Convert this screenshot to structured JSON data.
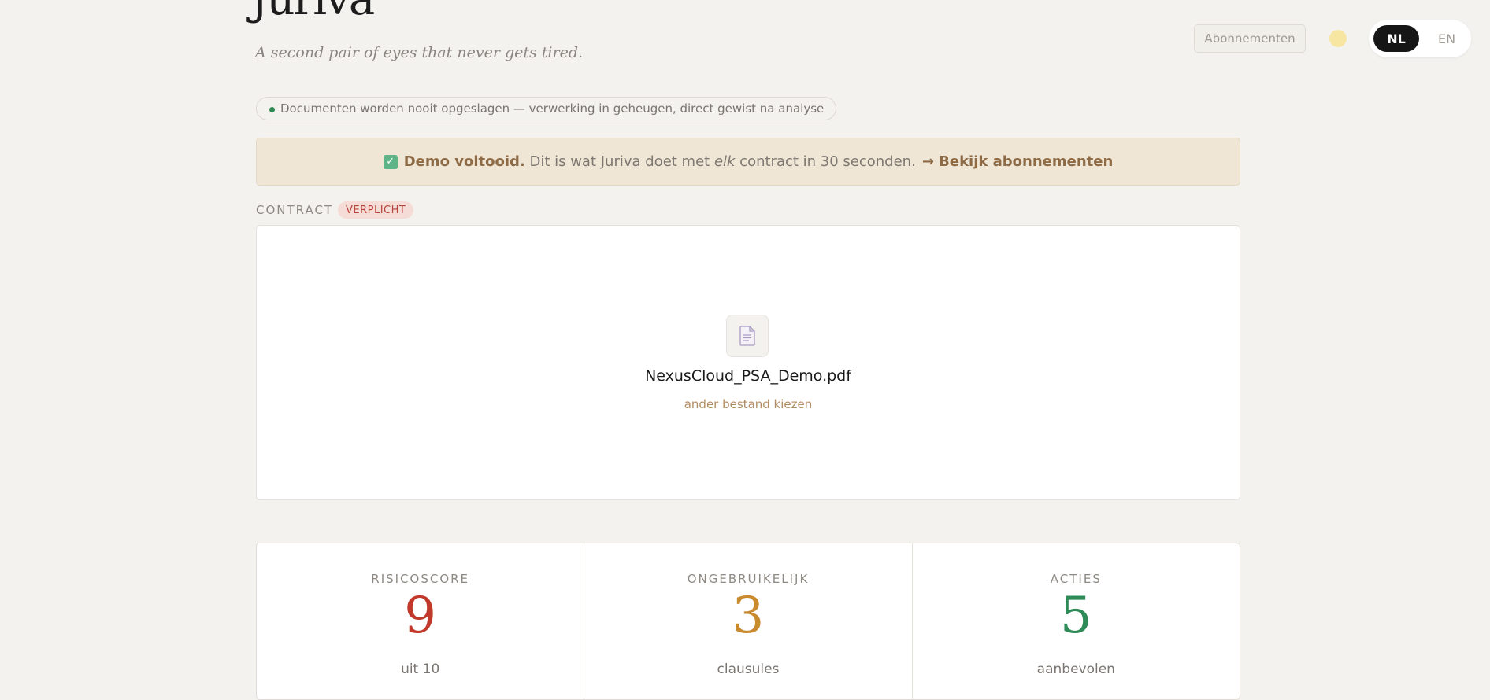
{
  "header": {
    "logo": "Juriva",
    "tagline": "A second pair of eyes that never gets tired.",
    "subscriptions_button": "Abonnementen",
    "theme_icon": "sun-icon",
    "lang": {
      "active": "NL",
      "other": "EN"
    }
  },
  "privacy_notice": "Documenten worden nooit opgeslagen — verwerking in geheugen, direct gewist na analyse",
  "banner": {
    "icon": "checkbox-icon",
    "bold": "Demo voltooid.",
    "text_before": " Dit is wat Juriva doet met ",
    "em": "elk",
    "text_after": " contract in 30 seconden.",
    "link": "→ Bekijk abonnementen"
  },
  "contract": {
    "label": "CONTRACT",
    "required_badge": "VERPLICHT",
    "file_icon": "document-icon",
    "file_name": "NexusCloud_PSA_Demo.pdf",
    "choose_other": "ander bestand kiezen"
  },
  "stats": [
    {
      "label": "RISICOSCORE",
      "value": "9",
      "sub": "uit 10",
      "color": "#c0392b"
    },
    {
      "label": "ONGEBRUIKELIJK",
      "value": "3",
      "sub": "clausules",
      "color": "#c98a2e"
    },
    {
      "label": "ACTIES",
      "value": "5",
      "sub": "aanbevolen",
      "color": "#2e8b57"
    }
  ]
}
